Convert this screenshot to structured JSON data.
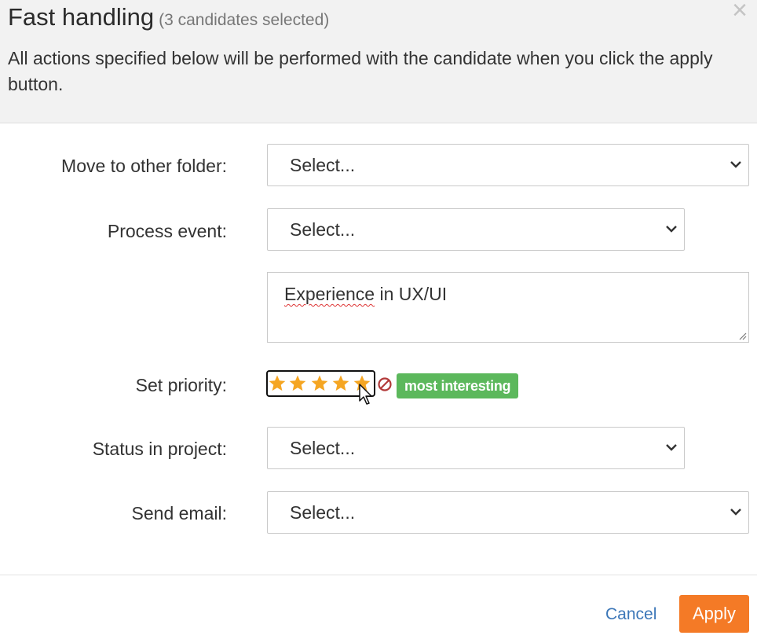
{
  "header": {
    "title": "Fast handling",
    "subtitle": "(3 candidates selected)",
    "close_icon": "close-icon",
    "description": "All actions specified below will be performed with the candidate when you click the apply button."
  },
  "form": {
    "move_folder": {
      "label": "Move to other folder:",
      "value": "Select..."
    },
    "process_event": {
      "label": "Process event:",
      "value": "Select..."
    },
    "note": {
      "misspelled": "Experience",
      "rest": " in UX/UI"
    },
    "priority": {
      "label": "Set priority:",
      "rating": 5,
      "max": 5,
      "badge": "most interesting"
    },
    "status_project": {
      "label": "Status in project:",
      "value": "Select..."
    },
    "send_email": {
      "label": "Send email:",
      "value": "Select..."
    }
  },
  "footer": {
    "cancel_label": "Cancel",
    "apply_label": "Apply"
  },
  "colors": {
    "accent": "#f47a26",
    "badge": "#5cb85c",
    "link": "#3c77b8",
    "star": "#f5a623"
  }
}
